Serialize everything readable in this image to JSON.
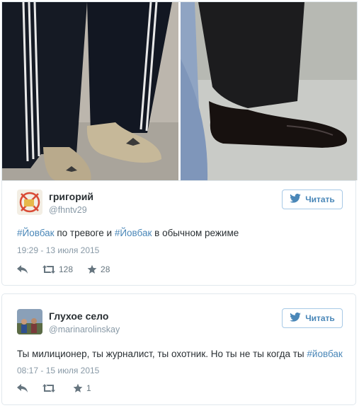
{
  "tweets": [
    {
      "name": "григорий",
      "handle": "@fhntv29",
      "follow_label": "Читать",
      "text_parts": [
        {
          "text": "#Йовбак",
          "hashtag": true
        },
        {
          "text": " по тревоге и ",
          "hashtag": false
        },
        {
          "text": "#Йовбак",
          "hashtag": true
        },
        {
          "text": " в обычном режиме",
          "hashtag": false
        }
      ],
      "time": "19:29 - 13 июля 2015",
      "retweets": "128",
      "favorites": "28"
    },
    {
      "name": "Глухое село",
      "handle": "@marinarolinskay",
      "follow_label": "Читать",
      "text_parts": [
        {
          "text": "Ты милиционер, ты журналист, ты охотник. Но ты не ты когда ты ",
          "hashtag": false
        },
        {
          "text": "#йовбак",
          "hashtag": true
        }
      ],
      "time": "08:17 - 15 июля 2015",
      "retweets": "",
      "favorites": "1"
    }
  ],
  "colors": {
    "link": "#4a87b8",
    "meta": "#8899a6",
    "border": "#e1e8ed"
  }
}
